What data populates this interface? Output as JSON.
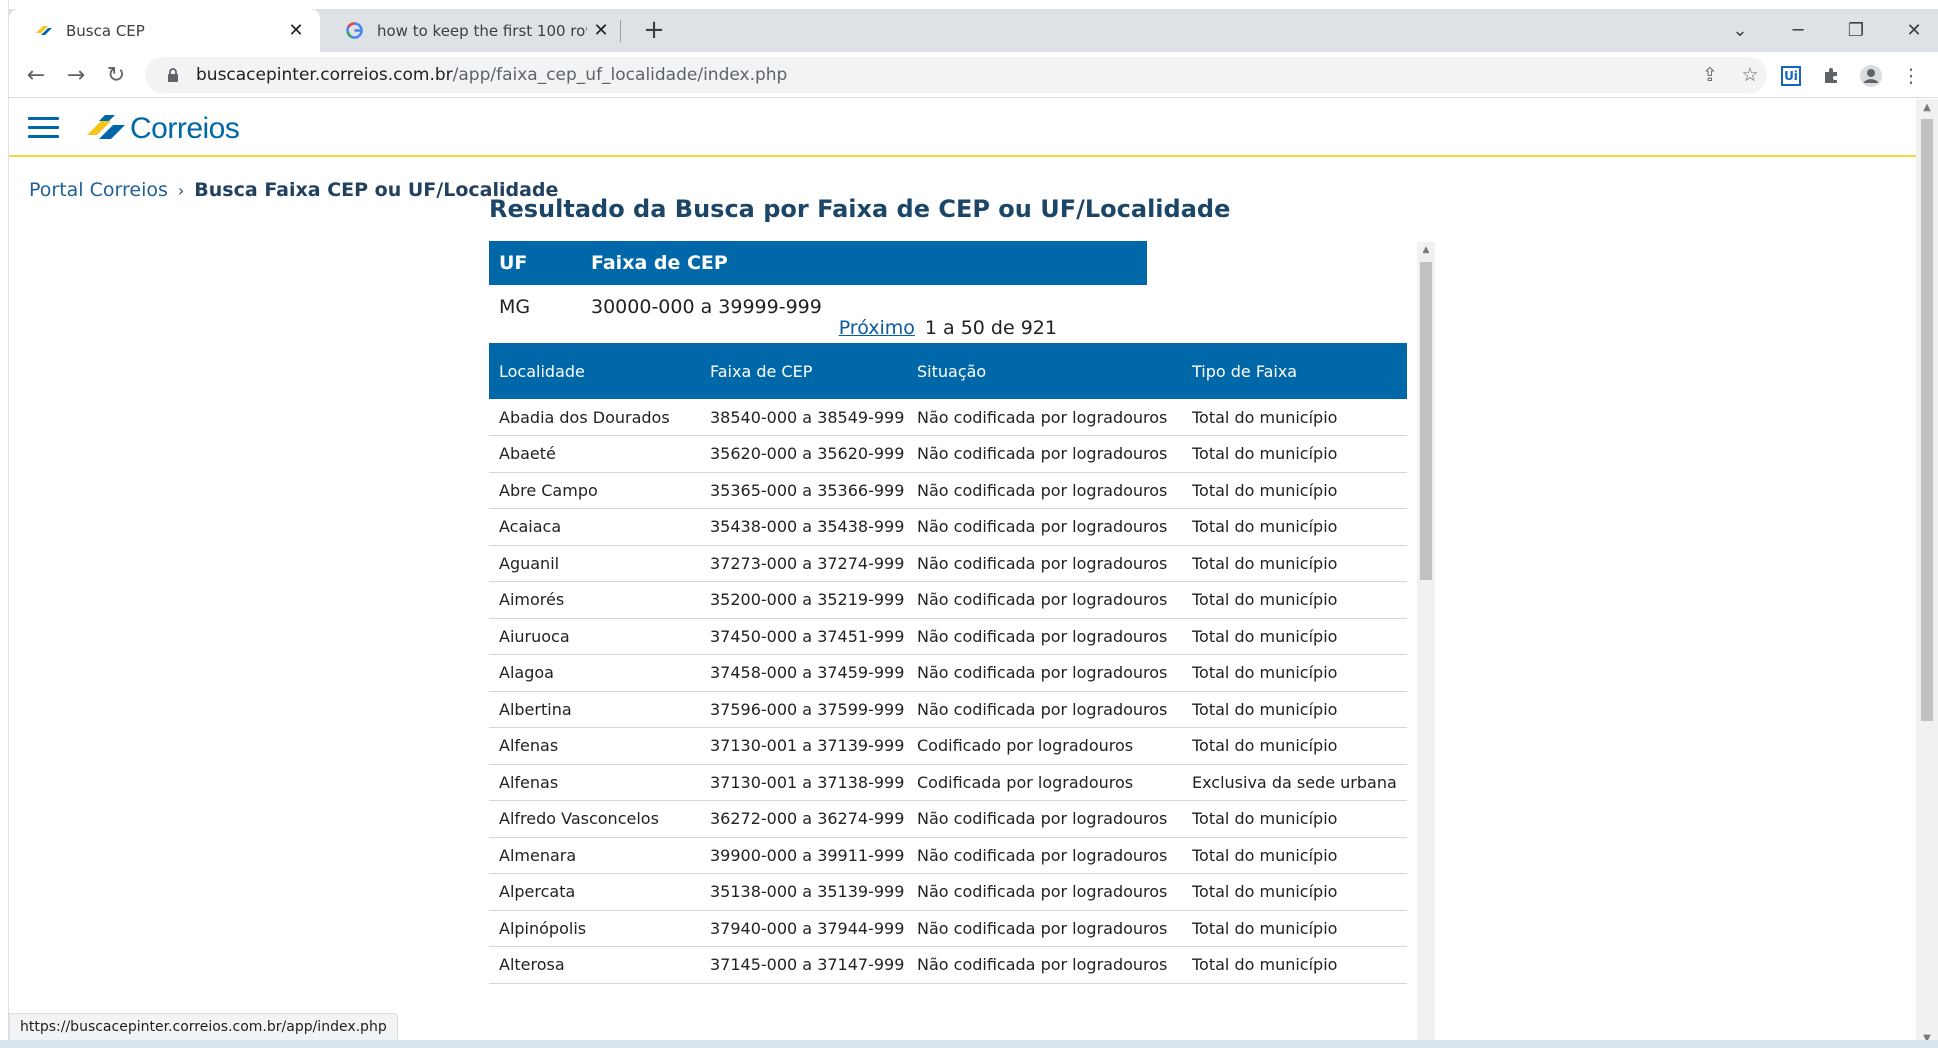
{
  "browser": {
    "tabs": [
      {
        "title": "Busca CEP",
        "favicon": "correios-favicon",
        "active": true
      },
      {
        "title": "how to keep the first 100 rows in",
        "favicon": "google-favicon",
        "active": false
      }
    ],
    "url_host": "buscacepinter.correios.com.br",
    "url_path": "/app/faixa_cep_uf_localidade/index.php",
    "status_url": "https://buscacepinter.correios.com.br/app/index.php"
  },
  "site": {
    "logo_text": "Correios",
    "brand_color": "#0067a8",
    "accent_color": "#f5d63c"
  },
  "breadcrumb": {
    "home": "Portal Correios",
    "separator": "›",
    "current": "Busca Faixa CEP ou UF/Localidade"
  },
  "result": {
    "title": "Resultado da Busca por Faixa de CEP ou UF/Localidade",
    "uf_header": "UF",
    "range_header": "Faixa de CEP",
    "uf_value": "MG",
    "range_value": "30000-000 a 39999-999"
  },
  "pager": {
    "next_label": "Próximo",
    "range_text": "1 a 50 de 921"
  },
  "table": {
    "headers": [
      "Localidade",
      "Faixa de CEP",
      "Situação",
      "Tipo de Faixa"
    ],
    "rows": [
      [
        "Abadia dos Dourados",
        "38540-000 a 38549-999",
        "Não codificada por logradouros",
        "Total do município"
      ],
      [
        "Abaeté",
        "35620-000 a 35620-999",
        "Não codificada por logradouros",
        "Total do município"
      ],
      [
        "Abre Campo",
        "35365-000 a 35366-999",
        "Não codificada por logradouros",
        "Total do município"
      ],
      [
        "Acaiaca",
        "35438-000 a 35438-999",
        "Não codificada por logradouros",
        "Total do município"
      ],
      [
        "Aguanil",
        "37273-000 a 37274-999",
        "Não codificada por logradouros",
        "Total do município"
      ],
      [
        "Aimorés",
        "35200-000 a 35219-999",
        "Não codificada por logradouros",
        "Total do município"
      ],
      [
        "Aiuruoca",
        "37450-000 a 37451-999",
        "Não codificada por logradouros",
        "Total do município"
      ],
      [
        "Alagoa",
        "37458-000 a 37459-999",
        "Não codificada por logradouros",
        "Total do município"
      ],
      [
        "Albertina",
        "37596-000 a 37599-999",
        "Não codificada por logradouros",
        "Total do município"
      ],
      [
        "Alfenas",
        "37130-001 a 37139-999",
        "Codificado por logradouros",
        "Total do município"
      ],
      [
        "Alfenas",
        "37130-001 a 37138-999",
        "Codificada por logradouros",
        "Exclusiva da sede urbana"
      ],
      [
        "Alfredo Vasconcelos",
        "36272-000 a 36274-999",
        "Não codificada por logradouros",
        "Total do município"
      ],
      [
        "Almenara",
        "39900-000 a 39911-999",
        "Não codificada por logradouros",
        "Total do município"
      ],
      [
        "Alpercata",
        "35138-000 a 35139-999",
        "Não codificada por logradouros",
        "Total do município"
      ],
      [
        "Alpinópolis",
        "37940-000 a 37944-999",
        "Não codificada por logradouros",
        "Total do município"
      ],
      [
        "Alterosa",
        "37145-000 a 37147-999",
        "Não codificada por logradouros",
        "Total do município"
      ]
    ]
  }
}
